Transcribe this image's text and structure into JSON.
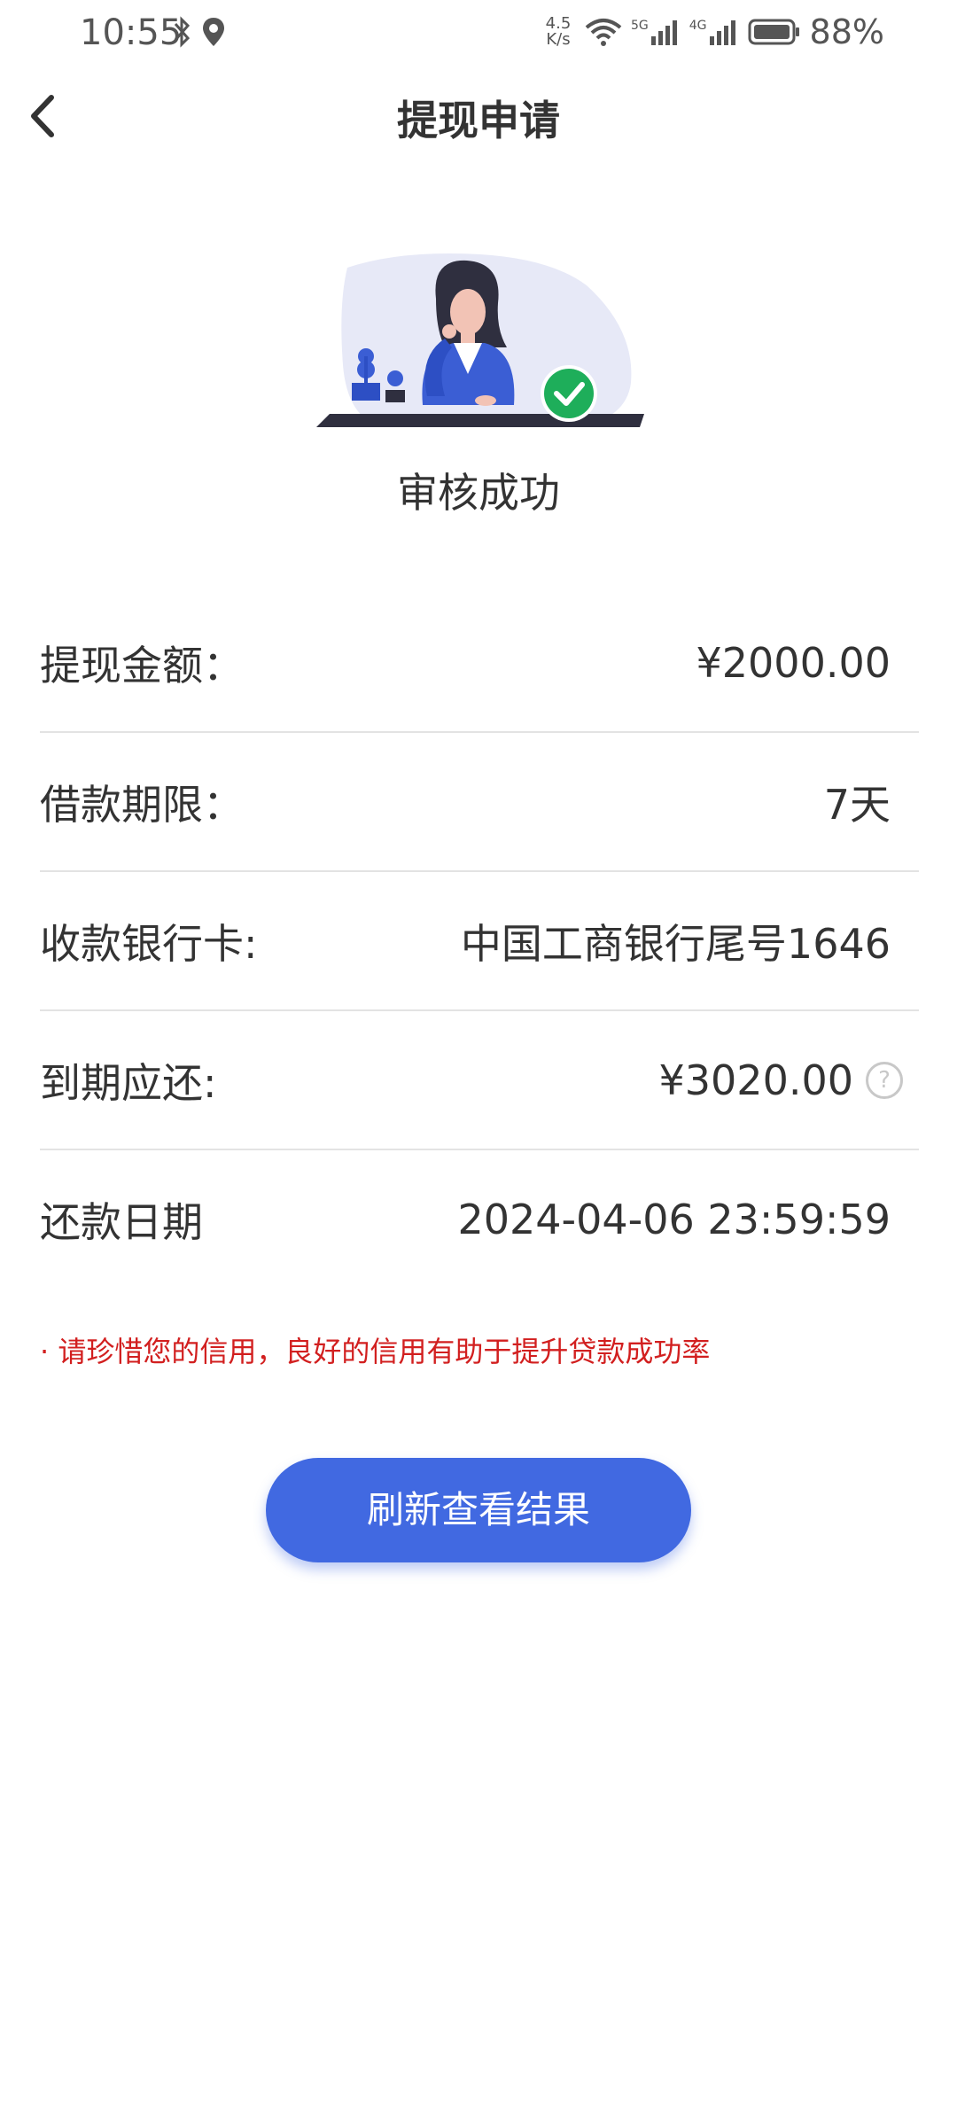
{
  "status_bar": {
    "time": "10:55",
    "net_speed_value": "4.5",
    "net_speed_unit": "K/s",
    "battery": "88%",
    "signal_1": "5G",
    "signal_2": "4G"
  },
  "header": {
    "title": "提现申请"
  },
  "result": {
    "status_text": "审核成功"
  },
  "details": [
    {
      "label": "提现金额：",
      "value": "¥2000.00"
    },
    {
      "label": "借款期限：",
      "value": "7天"
    },
    {
      "label": "收款银行卡:",
      "value": "中国工商银行尾号1646"
    },
    {
      "label": "到期应还:",
      "value": "¥3020.00"
    },
    {
      "label": "还款日期",
      "value": "2024-04-06 23:59:59"
    }
  ],
  "notice": "· 请珍惜您的信用，良好的信用有助于提升贷款成功率",
  "button": {
    "label": "刷新查看结果"
  },
  "colors": {
    "accent": "#4169e1",
    "notice": "#d21f1f",
    "success": "#1eae5a"
  }
}
